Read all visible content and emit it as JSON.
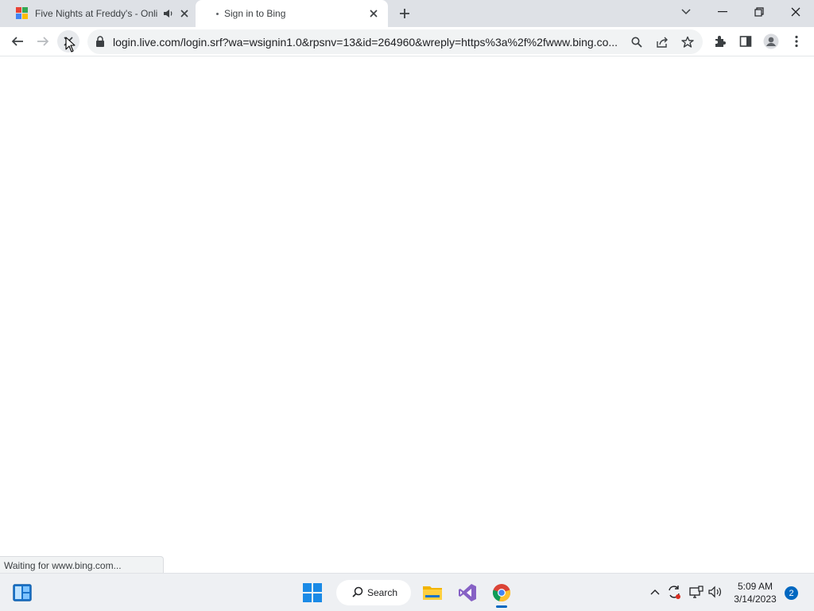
{
  "tabs": [
    {
      "title": "Five Nights at Freddy's - Onli",
      "active": false,
      "favicon": "games-grid-icon",
      "audio": "speaker-icon"
    },
    {
      "title": "Sign in to Bing",
      "active": true,
      "favicon": "loading-icon"
    }
  ],
  "address_bar": {
    "url": "login.live.com/login.srf?wa=wsignin1.0&rpsnv=13&id=264960&wreply=https%3a%2f%2fwww.bing.co..."
  },
  "status_bubble": {
    "text": "Waiting for www.bing.com..."
  },
  "taskbar": {
    "search_label": "Search",
    "time": "5:09 AM",
    "date": "3/14/2023",
    "notification_count": "2"
  },
  "colors": {
    "tabstrip": "#dee1e6",
    "omnibox": "#f1f3f4",
    "accent": "#0067c0"
  }
}
